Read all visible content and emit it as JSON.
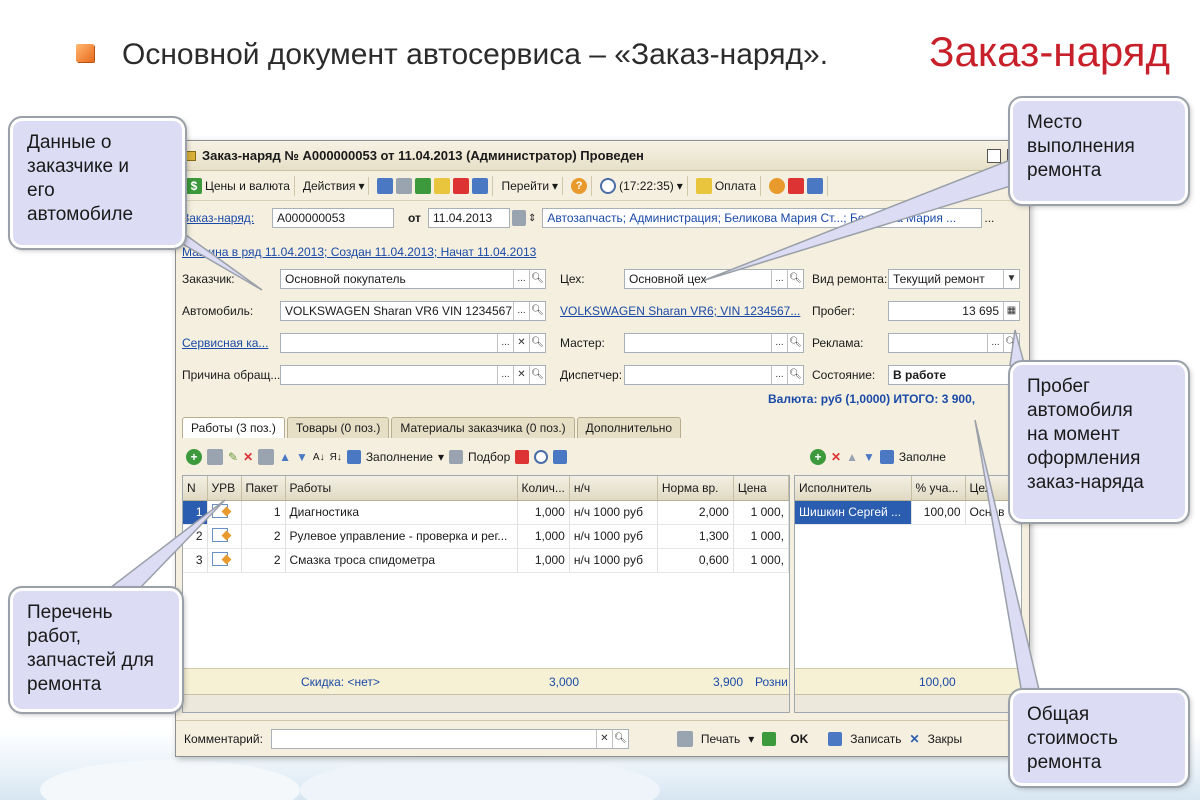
{
  "slide": {
    "heading": "Основной документ автосервиса – «Заказ-наряд».",
    "title": "Заказ-наряд"
  },
  "window": {
    "title": "Заказ-наряд № А000000053 от 11.04.2013 (Администратор) Проведен"
  },
  "toolbar": {
    "prices": "Цены и валюта",
    "actions": "Действия",
    "goto": "Перейти",
    "help": "?",
    "time": "(17:22:35)",
    "payment": "Оплата"
  },
  "header_form": {
    "doc_label": "Заказ-наряд:",
    "doc_number": "А000000053",
    "from_label": "от",
    "date": "11.04.2013",
    "org": "Автозапчасть; Администрация; Беликова Мария Ст...; Беликова Мария ...",
    "status_link": "Машина в ряд 11.04.2013; Создан 11.04.2013; Начат 11.04.2013",
    "customer_label": "Заказчик:",
    "customer_value": "Основной покупатель",
    "car_label": "Автомобиль:",
    "car_value": "VOLKSWAGEN Sharan VR6 VIN 1234567...",
    "service_card_label": "Сервисная ка...",
    "reason_label": "Причина обращ...",
    "shop_label": "Цех:",
    "shop_value": "Основной цех",
    "car_link": "VOLKSWAGEN Sharan VR6; VIN 1234567...",
    "master_label": "Мастер:",
    "dispatcher_label": "Диспетчер:",
    "repair_type_label": "Вид ремонта:",
    "repair_type_value": "Текущий ремонт",
    "mileage_label": "Пробег:",
    "mileage_value": "13 695",
    "ad_label": "Реклама:",
    "state_label": "Состояние:",
    "state_value": "В работе",
    "total_line": "Валюта: руб (1,0000) ИТОГО: 3 900,"
  },
  "tabs": [
    {
      "label": "Работы (3 поз.)"
    },
    {
      "label": "Товары (0 поз.)"
    },
    {
      "label": "Материалы заказчика (0 поз.)"
    },
    {
      "label": "Дополнительно"
    }
  ],
  "works_toolbar": {
    "fill": "Заполнение",
    "select": "Подбор"
  },
  "works_table": {
    "columns": [
      "N",
      "УРВ",
      "Пакет",
      "Работы",
      "Колич...",
      "н/ч",
      "Норма вр.",
      "Цена"
    ],
    "rows": [
      {
        "n": "1",
        "packet": "1",
        "work": "Диагностика",
        "qty": "1,000",
        "nh": "н/ч 1000 руб",
        "norm": "2,000",
        "price": "1 000,"
      },
      {
        "n": "2",
        "packet": "2",
        "work": "Рулевое управление - проверка и рег...",
        "qty": "1,000",
        "nh": "н/ч 1000 руб",
        "norm": "1,300",
        "price": "1 000,"
      },
      {
        "n": "3",
        "packet": "2",
        "work": "Смазка троса спидометра",
        "qty": "1,000",
        "nh": "н/ч 1000 руб",
        "norm": "0,600",
        "price": "1 000,"
      }
    ],
    "footer": {
      "discount": "Скидка: <нет>",
      "qty_total": "3,000",
      "norm_total": "3,900",
      "price_type": "Розни"
    }
  },
  "executors_toolbar": {
    "fill": "Заполне"
  },
  "executors_table": {
    "columns": [
      "Исполнитель",
      "% уча...",
      "Цех"
    ],
    "rows": [
      {
        "name": "Шишкин Сергей ...",
        "pct": "100,00",
        "shop": "Основ"
      }
    ],
    "footer": {
      "pct_total": "100,00"
    }
  },
  "bottom": {
    "comment_label": "Комментарий:",
    "print": "Печать",
    "ok": "OK",
    "save": "Записать",
    "close": "Закры"
  },
  "callouts": {
    "customer": [
      "Данные о",
      "заказчике и",
      "его",
      "автомобиле"
    ],
    "location": [
      "Место",
      "выполнения",
      "ремонта"
    ],
    "mileage": [
      "Пробег",
      "автомобиля",
      "на момент",
      "оформления",
      "заказ-наряда"
    ],
    "works": [
      "Перечень",
      "работ,",
      "запчастей для",
      "ремонта"
    ],
    "total": [
      "Общая",
      "стоимость",
      "ремонта"
    ]
  }
}
